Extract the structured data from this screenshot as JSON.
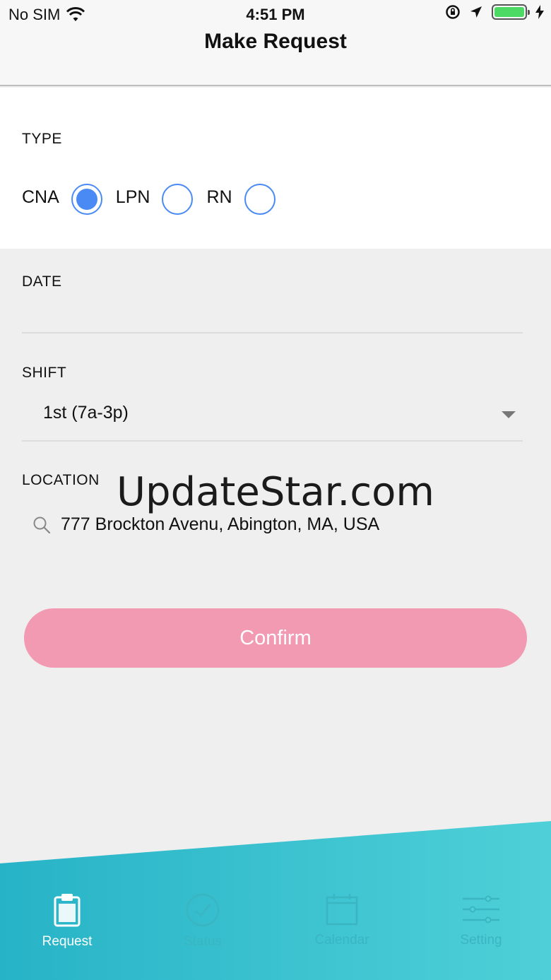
{
  "status_bar": {
    "carrier": "No SIM",
    "time": "4:51 PM"
  },
  "nav": {
    "title": "Make Request"
  },
  "type": {
    "label": "TYPE",
    "options": [
      {
        "label": "CNA",
        "selected": true
      },
      {
        "label": "LPN",
        "selected": false
      },
      {
        "label": "RN",
        "selected": false
      }
    ]
  },
  "date": {
    "label": "DATE",
    "value": ""
  },
  "shift": {
    "label": "SHIFT",
    "value": "1st (7a-3p)"
  },
  "location": {
    "label": "LOCATION",
    "value": "777 Brockton Avenu, Abington, MA, USA"
  },
  "watermark": "UpdateStar.com",
  "confirm_label": "Confirm",
  "tabs": [
    {
      "label": "Request",
      "icon": "clipboard-icon",
      "active": true
    },
    {
      "label": "Status",
      "icon": "check-circle-icon",
      "active": false
    },
    {
      "label": "Calendar",
      "icon": "calendar-icon",
      "active": false
    },
    {
      "label": "Setting",
      "icon": "sliders-icon",
      "active": false
    }
  ],
  "colors": {
    "accent": "#4a8af4",
    "confirm_bg": "#f29ab2",
    "tab_gradient_start": "#27b3c7",
    "tab_gradient_end": "#4fd0d8",
    "battery": "#4cd964"
  }
}
